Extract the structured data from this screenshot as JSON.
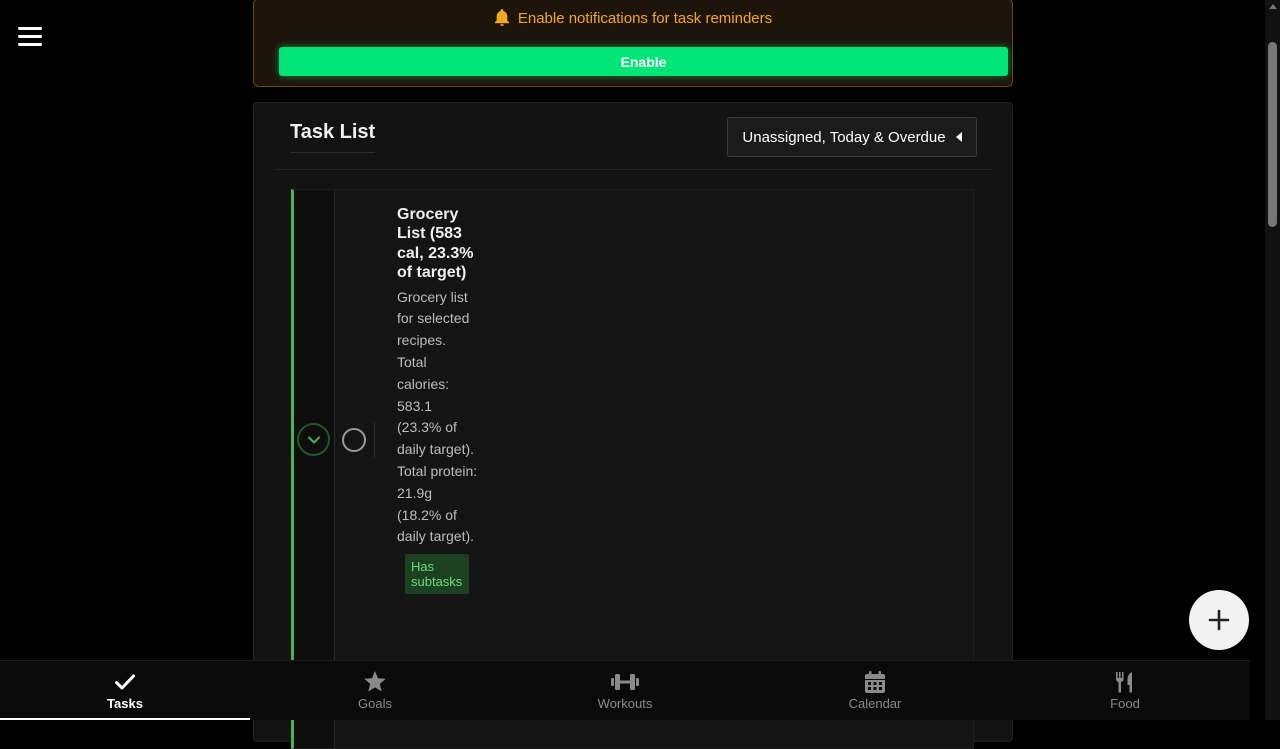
{
  "notification": {
    "message": "Enable notifications for task reminders",
    "button_label": "Enable"
  },
  "task_list": {
    "title": "Task List",
    "filter_label": "Unassigned, Today & Overdue"
  },
  "task": {
    "title": "Grocery List (583 cal, 23.3% of target)",
    "description": "Grocery list for selected recipes. Total calories: 583.1 (23.3% of daily target). Total protein: 21.9g (18.2% of daily target).",
    "badge": "Has subtasks"
  },
  "nav": {
    "items": [
      {
        "label": "Tasks",
        "icon": "check-icon",
        "active": true
      },
      {
        "label": "Goals",
        "icon": "star-icon"
      },
      {
        "label": "Workouts",
        "icon": "dumbbell-icon"
      },
      {
        "label": "Calendar",
        "icon": "calendar-icon"
      },
      {
        "label": "Food",
        "icon": "utensils-icon"
      }
    ]
  },
  "colors": {
    "accent_green": "#00e676",
    "warning_orange": "#f5a623",
    "task_border": "#4caf50"
  }
}
